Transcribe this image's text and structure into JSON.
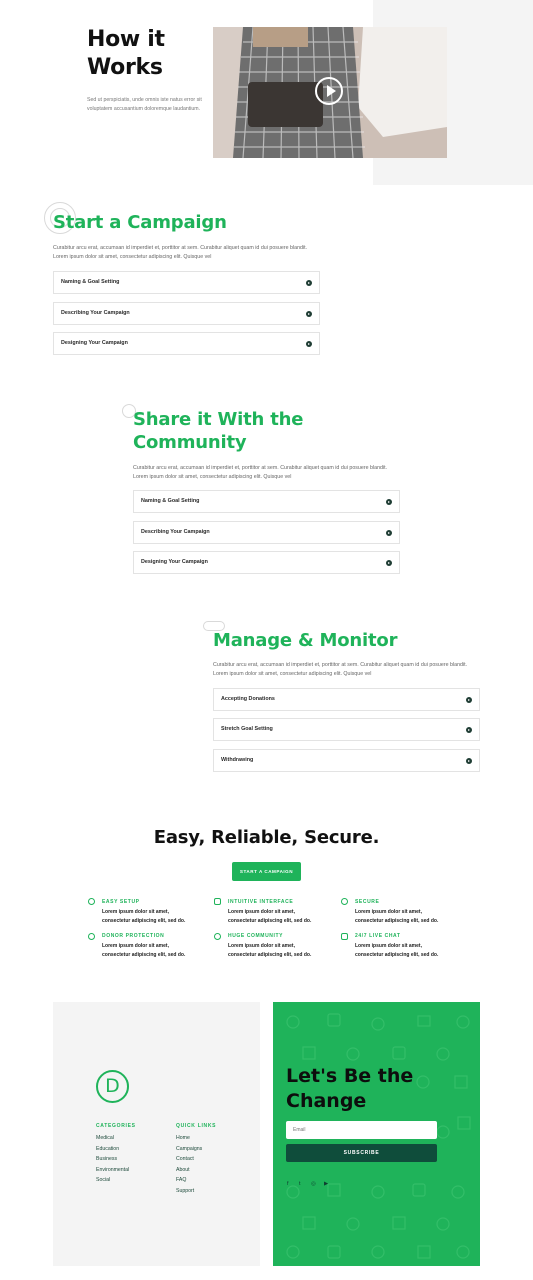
{
  "hero": {
    "title_line1": "How it",
    "title_line2": "Works",
    "text": "Sed ut perspiciatis, unde omnis iste natus error sit voluptatem accusantium doloremque laudantium."
  },
  "sections": [
    {
      "title": "Start a Campaign",
      "text": "Curabitur arcu erat, accumsan id imperdiet et, porttitor at sem. Curabitur aliquet quam id dui posuere blandit. Lorem ipsum dolor sit amet, consectetur adipiscing elit. Quisque vel",
      "items": [
        "Naming & Goal Setting",
        "Describing Your Campaign",
        "Designing Your Campaign"
      ]
    },
    {
      "title_line1": "Share it With the",
      "title_line2": "Community",
      "text": "Curabitur arcu erat, accumsan id imperdiet et, porttitor at sem. Curabitur aliquet quam id dui posuere blandit. Lorem ipsum dolor sit amet, consectetur adipiscing elit. Quisque vel",
      "items": [
        "Naming & Goal Setting",
        "Describing Your Campaign",
        "Designing Your Campaign"
      ]
    },
    {
      "title": "Manage & Monitor",
      "text": "Curabitur arcu erat, accumsan id imperdiet et, porttitor at sem. Curabitur aliquet quam id dui posuere blandit. Lorem ipsum dolor sit amet, consectetur adipiscing elit. Quisque vel",
      "items": [
        "Accepting Donations",
        "Stretch Goal Setting",
        "Withdrawing"
      ]
    }
  ],
  "easy": {
    "title": "Easy, Reliable, Secure.",
    "button": "START A CAMPAIGN",
    "features": [
      {
        "icon": "lightbulb-icon",
        "title": "EASY SETUP",
        "text1": "Lorem ipsum dolor sit amet,",
        "text2": "consectetur adipiscing elit, sed do."
      },
      {
        "icon": "interface-icon",
        "title": "INTUITIVE INTERFACE",
        "text1": "Lorem ipsum dolor sit amet,",
        "text2": "consectetur adipiscing elit, sed do."
      },
      {
        "icon": "secure-icon",
        "title": "SECURE",
        "text1": "Lorem ipsum dolor sit amet,",
        "text2": "consectetur adipiscing elit, sed do."
      },
      {
        "icon": "heart-icon",
        "title": "DONOR PROTECTION",
        "text1": "Lorem ipsum dolor sit amet,",
        "text2": "consectetur adipiscing elit, sed do."
      },
      {
        "icon": "community-icon",
        "title": "HUGE COMMUNITY",
        "text1": "Lorem ipsum dolor sit amet,",
        "text2": "consectetur adipiscing elit, sed do."
      },
      {
        "icon": "chat-icon",
        "title": "24/7 LIVE CHAT",
        "text1": "Lorem ipsum dolor sit amet,",
        "text2": "consectetur adipiscing elit, sed do."
      }
    ]
  },
  "footer": {
    "logo_letter": "D",
    "categories": {
      "heading": "CATEGORIES",
      "links": [
        "Medical",
        "Education",
        "Business",
        "Environmental",
        "Social"
      ]
    },
    "quick_links": {
      "heading": "QUICK LINKS",
      "links": [
        "Home",
        "Campaigns",
        "Contact",
        "About",
        "FAQ",
        "Support"
      ]
    },
    "cta_line1": "Let's Be the",
    "cta_line2": "Change",
    "email_placeholder": "Email",
    "subscribe": "SUBSCRIBE",
    "social": [
      "f",
      "t",
      "◎",
      "▶"
    ]
  },
  "colors": {
    "accent": "#1fb35a",
    "dark_green": "#0f4d3b"
  }
}
